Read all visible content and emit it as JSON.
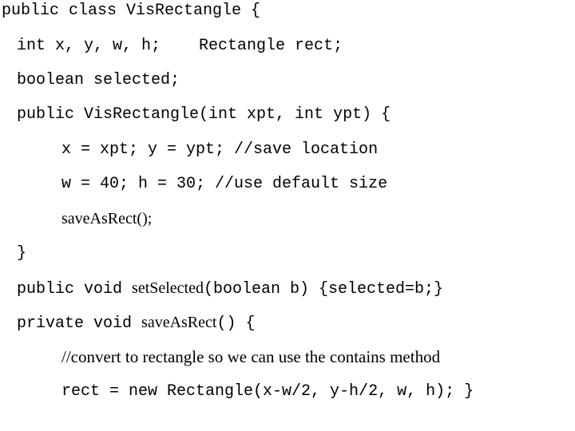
{
  "slide": {
    "background_color": "#ffffff",
    "text_color": "#000000",
    "title": "public class VisRectangle {",
    "language": "java"
  },
  "code": {
    "lines": [
      {
        "n": 1,
        "indent": 0,
        "font": "mono",
        "text": "public class VisRectangle {"
      },
      {
        "n": 2,
        "indent": 1,
        "font": "mono",
        "text": "int x, y, w, h;    Rectangle rect;"
      },
      {
        "n": 3,
        "indent": 1,
        "font": "mono",
        "text": "boolean selected;"
      },
      {
        "n": 4,
        "indent": 1,
        "font": "mono",
        "text": "public VisRectangle(int xpt, int ypt) {"
      },
      {
        "n": 5,
        "indent": 2,
        "font": "mono",
        "text": "x = xpt; y = ypt; //save location"
      },
      {
        "n": 6,
        "indent": 2,
        "font": "mono",
        "text": "w = 40; h = 30; //use default size"
      },
      {
        "n": 7,
        "indent": 2,
        "font": "serif",
        "text": "saveAsRect();"
      },
      {
        "n": 8,
        "indent": 1,
        "font": "mono",
        "text": "}"
      },
      {
        "n": 9,
        "indent": 1,
        "font": "mono-mixed",
        "pre": "public void ",
        "mid": "setSelected",
        "post": "(boolean b) {selected=b;}",
        "text": "public void setSelected(boolean b) {selected=b;}"
      },
      {
        "n": 10,
        "indent": 1,
        "font": "mono-mixed",
        "pre": "private void ",
        "mid": "saveAsRect",
        "post": "() {",
        "text": "private void saveAsRect() {"
      },
      {
        "n": 11,
        "indent": 2,
        "font": "serif",
        "text": "//convert to rectangle so we can use the contains method"
      },
      {
        "n": 12,
        "indent": 2,
        "font": "mono",
        "text": "rect = new Rectangle(x-w/2, y-h/2, w, h); }"
      }
    ]
  }
}
